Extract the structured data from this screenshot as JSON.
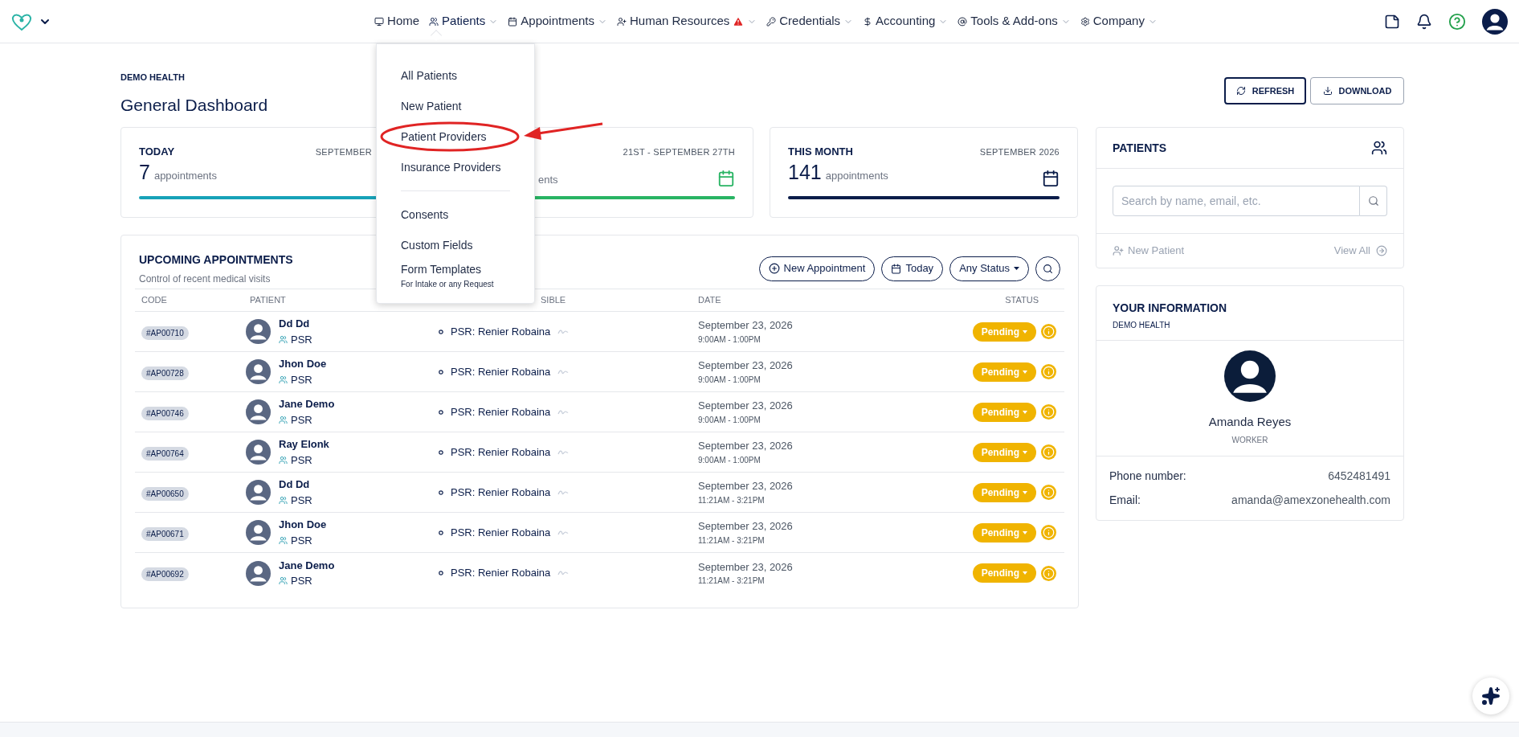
{
  "nav": {
    "items": [
      {
        "label": "Home",
        "has_menu": false,
        "expanded": false,
        "warning": false
      },
      {
        "label": "Patients",
        "has_menu": true,
        "expanded": true,
        "warning": false
      },
      {
        "label": "Appointments",
        "has_menu": true,
        "expanded": false,
        "warning": false
      },
      {
        "label": "Human Resources",
        "has_menu": true,
        "expanded": false,
        "warning": true
      },
      {
        "label": "Credentials",
        "has_menu": true,
        "expanded": false,
        "warning": false
      },
      {
        "label": "Accounting",
        "has_menu": true,
        "expanded": false,
        "warning": false
      },
      {
        "label": "Tools & Add-ons",
        "has_menu": true,
        "expanded": false,
        "warning": false
      },
      {
        "label": "Company",
        "has_menu": true,
        "expanded": false,
        "warning": false
      }
    ]
  },
  "patients_menu": {
    "groups": [
      [
        {
          "label": "All Patients",
          "circled": false
        },
        {
          "label": "New Patient",
          "circled": false
        },
        {
          "label": "Patient Providers",
          "circled": true
        },
        {
          "label": "Insurance Providers",
          "circled": false
        }
      ],
      [
        {
          "label": "Consents",
          "circled": false
        },
        {
          "label": "Custom Fields",
          "circled": false
        },
        {
          "label": "Form Templates",
          "hint": "For Intake or any Request",
          "circled": false
        }
      ]
    ]
  },
  "header": {
    "org": "DEMO HEALTH",
    "title": "General Dashboard",
    "buttons": [
      "REFRESH",
      "DOWNLOAD"
    ]
  },
  "stat_cards": [
    {
      "title": "TODAY",
      "period": "SEPTEMBER",
      "count": "7",
      "unit": "appointments",
      "color": "#17a2b8"
    },
    {
      "period": "21ST - SEPTEMBER 27TH",
      "unit": "ents",
      "color": "#28b463"
    },
    {
      "title": "THIS MONTH",
      "period": "SEPTEMBER 2026",
      "count": "141",
      "unit": "appointments",
      "color": "#0b1d4a"
    }
  ],
  "appointments": {
    "title": "UPCOMING APPOINTMENTS",
    "subtitle": "Control of recent medical visits",
    "actions": [
      "New Appointment",
      "Today",
      "Any Status"
    ],
    "columns": [
      "CODE",
      "PATIENT",
      "SIBLE",
      "DATE",
      "STATUS"
    ],
    "rows": [
      {
        "code": "#AP00710",
        "patient": "Dd Dd",
        "group": "PSR",
        "responsible": "PSR: Renier Robaina",
        "date": "September 23, 2026",
        "time": "9:00AM - 1:00PM",
        "status": "Pending"
      },
      {
        "code": "#AP00728",
        "patient": "Jhon Doe",
        "group": "PSR",
        "responsible": "PSR: Renier Robaina",
        "date": "September 23, 2026",
        "time": "9:00AM - 1:00PM",
        "status": "Pending"
      },
      {
        "code": "#AP00746",
        "patient": "Jane Demo",
        "group": "PSR",
        "responsible": "PSR: Renier Robaina",
        "date": "September 23, 2026",
        "time": "9:00AM - 1:00PM",
        "status": "Pending"
      },
      {
        "code": "#AP00764",
        "patient": "Ray Elonk",
        "group": "PSR",
        "responsible": "PSR: Renier Robaina",
        "date": "September 23, 2026",
        "time": "9:00AM - 1:00PM",
        "status": "Pending"
      },
      {
        "code": "#AP00650",
        "patient": "Dd Dd",
        "group": "PSR",
        "responsible": "PSR: Renier Robaina",
        "date": "September 23, 2026",
        "time": "11:21AM - 3:21PM",
        "status": "Pending"
      },
      {
        "code": "#AP00671",
        "patient": "Jhon Doe",
        "group": "PSR",
        "responsible": "PSR: Renier Robaina",
        "date": "September 23, 2026",
        "time": "11:21AM - 3:21PM",
        "status": "Pending"
      },
      {
        "code": "#AP00692",
        "patient": "Jane Demo",
        "group": "PSR",
        "responsible": "PSR: Renier Robaina",
        "date": "September 23, 2026",
        "time": "11:21AM - 3:21PM",
        "status": "Pending"
      }
    ]
  },
  "patients_panel": {
    "title": "PATIENTS",
    "search_placeholder": "Search by name, email, etc.",
    "new_patient": "New Patient",
    "view_all": "View All"
  },
  "your_information": {
    "title": "YOUR INFORMATION",
    "subtitle": "DEMO HEALTH",
    "name": "Amanda Reyes",
    "role": "WORKER",
    "fields": [
      {
        "label": "Phone number:",
        "value": "6452481491"
      },
      {
        "label": "Email:",
        "value": "amanda@amexzonehealth.com"
      }
    ]
  }
}
